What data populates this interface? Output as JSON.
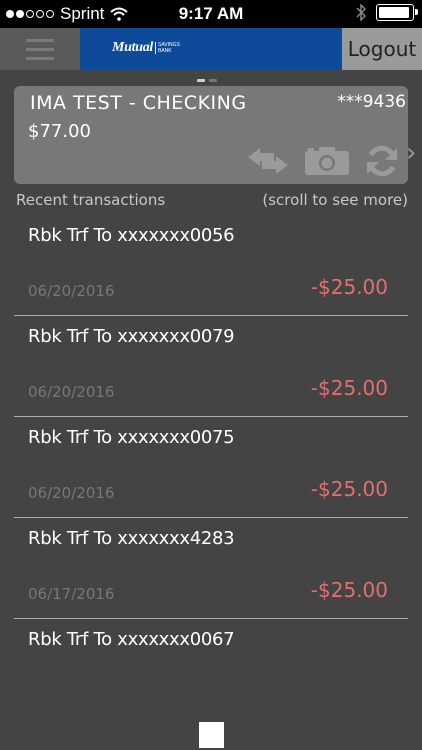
{
  "status_bar": {
    "carrier": "Sprint",
    "time": "9:17 AM",
    "signal_full": 2,
    "signal_empty": 3
  },
  "header": {
    "logo_text": "Mutual",
    "logo_sub_1": "SAVINGS",
    "logo_sub_2": "BANK",
    "logout_label": "Logout",
    "brand_color": "#0d4b9a"
  },
  "pager": {
    "count": 2,
    "active": 0
  },
  "account": {
    "name": "IMA TEST - CHECKING",
    "number": "***9436",
    "balance": "$77.00"
  },
  "transactions_header": {
    "label": "Recent transactions",
    "hint": "(scroll to see more)"
  },
  "transactions": [
    {
      "description": "Rbk Trf To xxxxxxx0056",
      "date": "06/20/2016",
      "amount": "-$25.00"
    },
    {
      "description": "Rbk Trf To xxxxxxx0079",
      "date": "06/20/2016",
      "amount": "-$25.00"
    },
    {
      "description": "Rbk Trf To xxxxxxx0075",
      "date": "06/20/2016",
      "amount": "-$25.00"
    },
    {
      "description": "Rbk Trf To xxxxxxx4283",
      "date": "06/17/2016",
      "amount": "-$25.00"
    },
    {
      "description": "Rbk Trf To xxxxxxx0067",
      "date": "",
      "amount": ""
    }
  ],
  "colors": {
    "negative_amount": "#e07070",
    "background": "#444444",
    "card": "#787878"
  },
  "icons": [
    "menu-icon",
    "transfer-icon",
    "camera-icon",
    "refresh-icon",
    "chevron-right-icon",
    "wifi-icon",
    "bluetooth-icon",
    "battery-icon"
  ]
}
